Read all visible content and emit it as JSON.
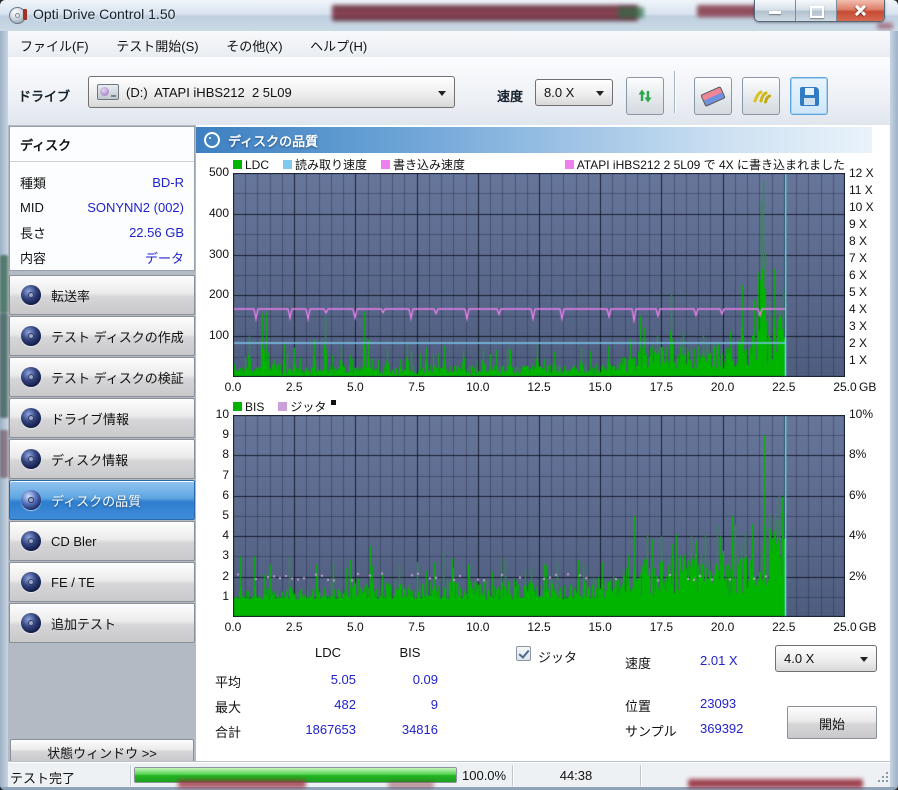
{
  "window": {
    "title": "Opti Drive Control 1.50"
  },
  "menu": {
    "items": [
      {
        "label": "ファイル(F)"
      },
      {
        "label": "テスト開始(S)"
      },
      {
        "label": "その他(X)"
      },
      {
        "label": "ヘルプ(H)"
      }
    ]
  },
  "toolbar": {
    "drive_label": "ドライブ",
    "drive_value": "(D:)  ATAPI iHBS212  2 5L09",
    "speed_label": "速度",
    "speed_value": "8.0 X"
  },
  "sidebar": {
    "info_title": "ディスク",
    "info_rows": [
      {
        "label": "種類",
        "value": "BD-R"
      },
      {
        "label": "MID",
        "value": "SONYNN2 (002)"
      },
      {
        "label": "長さ",
        "value": "22.56 GB"
      },
      {
        "label": "内容",
        "value": "データ"
      }
    ],
    "items": [
      {
        "label": "転送率"
      },
      {
        "label": "テスト ディスクの作成"
      },
      {
        "label": "テスト ディスクの検証"
      },
      {
        "label": "ドライブ情報"
      },
      {
        "label": "ディスク情報"
      },
      {
        "label": "ディスクの品質"
      },
      {
        "label": "CD Bler"
      },
      {
        "label": "FE / TE"
      },
      {
        "label": "追加テスト"
      }
    ],
    "selected_item": "ディスクの品質",
    "status_window_button": "状態ウィンドウ >>"
  },
  "main": {
    "header": "ディスクの品質"
  },
  "chart_data": {
    "type": "area",
    "title": "ディスクの品質",
    "x_range_gb": [
      0,
      25
    ],
    "x_tick_labels": [
      "0.0",
      "2.5",
      "5.0",
      "7.5",
      "10.0",
      "12.5",
      "15.0",
      "17.5",
      "20.0",
      "22.5",
      "25.0"
    ],
    "x_axis_unit": "GB",
    "data_end_gb": 22.56,
    "end_marker_color": "#76dcf8",
    "style": {
      "bg_top": "#67769b",
      "bg_bottom": "#4e5d7f",
      "grid_minor": "rgba(23,30,48,0.35)",
      "grid_major": "rgba(8,12,24,0.8)",
      "border": "#141b2c"
    },
    "top_chart": {
      "legend": [
        {
          "label": "LDC",
          "color": "#00b400"
        },
        {
          "label": "読み取り速度",
          "color": "#7fc9ee"
        },
        {
          "label": "書き込み速度",
          "color": "#ee7fee"
        }
      ],
      "annotation": {
        "label": "ATAPI iHBS212  2 5L09 で 4X に書き込まれました",
        "color": "#ee7fee"
      },
      "y_left_ticks": [
        500,
        400,
        300,
        200,
        100
      ],
      "y_left_range": [
        0,
        500
      ],
      "y_right_ticks": [
        "12 X",
        "11 X",
        "10 X",
        "9 X",
        "8 X",
        "7 X",
        "6 X",
        "5 X",
        "4 X",
        "3 X",
        "2 X",
        "1 X"
      ],
      "read_speed_x": 2.0,
      "write_speed_x": 4.0,
      "ldc_envelope": [
        [
          0,
          18
        ],
        [
          1,
          20
        ],
        [
          1.2,
          60
        ],
        [
          2,
          20
        ],
        [
          4,
          22
        ],
        [
          6,
          20
        ],
        [
          8,
          24
        ],
        [
          10,
          22
        ],
        [
          12,
          24
        ],
        [
          14,
          22
        ],
        [
          15.5,
          28
        ],
        [
          16,
          40
        ],
        [
          16.5,
          55
        ],
        [
          17,
          60
        ],
        [
          18,
          60
        ],
        [
          19,
          65
        ],
        [
          20,
          70
        ],
        [
          21,
          78
        ],
        [
          21.5,
          88
        ],
        [
          22,
          98
        ],
        [
          22.3,
          115
        ],
        [
          22.56,
          135
        ]
      ],
      "ldc_spikes": [
        [
          0.65,
          100
        ],
        [
          1.2,
          155
        ],
        [
          2.1,
          80
        ],
        [
          2.5,
          72
        ],
        [
          3.3,
          92
        ],
        [
          3.75,
          150
        ],
        [
          4.4,
          76
        ],
        [
          5.35,
          160
        ],
        [
          5.5,
          92
        ],
        [
          6.3,
          72
        ],
        [
          7.1,
          86
        ],
        [
          7.9,
          72
        ],
        [
          8.6,
          76
        ],
        [
          9.4,
          66
        ],
        [
          10.2,
          72
        ],
        [
          11.3,
          66
        ],
        [
          12.4,
          82
        ],
        [
          13.1,
          62
        ],
        [
          14.2,
          72
        ],
        [
          15.3,
          76
        ],
        [
          16.2,
          92
        ],
        [
          16.8,
          122
        ],
        [
          17.3,
          102
        ],
        [
          17.9,
          205
        ],
        [
          18.3,
          92
        ],
        [
          19.2,
          102
        ],
        [
          20.3,
          112
        ],
        [
          20.8,
          225
        ],
        [
          21.3,
          190
        ],
        [
          21.45,
          255
        ],
        [
          21.55,
          430
        ],
        [
          21.65,
          480
        ],
        [
          21.75,
          305
        ],
        [
          21.9,
          185
        ],
        [
          22.1,
          265
        ],
        [
          22.3,
          175
        ],
        [
          22.45,
          215
        ]
      ]
    },
    "bottom_chart": {
      "legend": [
        {
          "label": "BIS",
          "color": "#00b400"
        },
        {
          "label": "ジッタ",
          "color": "#c9a0d9"
        }
      ],
      "y_left_ticks": [
        10,
        9,
        8,
        7,
        6,
        5,
        4,
        3,
        2,
        1
      ],
      "y_left_range": [
        0,
        10
      ],
      "y_right_ticks": [
        "10%",
        "8%",
        "6%",
        "4%",
        "2%"
      ],
      "bis_envelope": [
        [
          0,
          1.0
        ],
        [
          2,
          1.15
        ],
        [
          4,
          1.25
        ],
        [
          6,
          1.3
        ],
        [
          8,
          1.35
        ],
        [
          10,
          1.45
        ],
        [
          12,
          1.5
        ],
        [
          14,
          1.55
        ],
        [
          15.5,
          1.7
        ],
        [
          16,
          2.0
        ],
        [
          17,
          2.3
        ],
        [
          18,
          2.4
        ],
        [
          19,
          2.5
        ],
        [
          20,
          2.6
        ],
        [
          21,
          3.0
        ],
        [
          21.5,
          3.2
        ],
        [
          22,
          3.5
        ],
        [
          22.56,
          4.2
        ]
      ],
      "bis_spikes": [
        [
          0.3,
          3
        ],
        [
          0.85,
          3
        ],
        [
          1.5,
          2.6
        ],
        [
          2.3,
          3
        ],
        [
          3.4,
          2.6
        ],
        [
          4.1,
          2.7
        ],
        [
          5.6,
          3.5
        ],
        [
          6.8,
          2.6
        ],
        [
          8.2,
          2.7
        ],
        [
          9.6,
          2.6
        ],
        [
          11.1,
          2.7
        ],
        [
          12.7,
          2.6
        ],
        [
          14.3,
          2.7
        ],
        [
          16.4,
          5
        ],
        [
          16.9,
          4.1
        ],
        [
          17.5,
          4
        ],
        [
          18.1,
          4.1
        ],
        [
          18.7,
          4
        ],
        [
          19.3,
          4.1
        ],
        [
          19.9,
          4
        ],
        [
          20.4,
          5
        ],
        [
          20.9,
          4.2
        ],
        [
          21.2,
          4.6
        ],
        [
          21.7,
          9
        ],
        [
          21.9,
          5.1
        ],
        [
          22.15,
          5
        ],
        [
          22.3,
          6
        ],
        [
          22.45,
          5.2
        ]
      ]
    }
  },
  "stats": {
    "col_headers": [
      "LDC",
      "BIS"
    ],
    "rows": [
      {
        "label": "平均",
        "ldc": "5.05",
        "bis": "0.09"
      },
      {
        "label": "最大",
        "ldc": "482",
        "bis": "9"
      },
      {
        "label": "合計",
        "ldc": "1867653",
        "bis": "34816"
      }
    ],
    "jitter_label": "ジッタ",
    "jitter_checked": true,
    "speed_label": "速度",
    "speed_value": "2.01 X",
    "position_label": "位置",
    "position_value": "23093",
    "samples_label": "サンプル",
    "samples_value": "369392",
    "speed_select": "4.0 X",
    "start_button": "開始"
  },
  "statusbar": {
    "status": "テスト完了",
    "progress_label": "100.0%",
    "progress_percent": 100,
    "time": "44:38"
  }
}
